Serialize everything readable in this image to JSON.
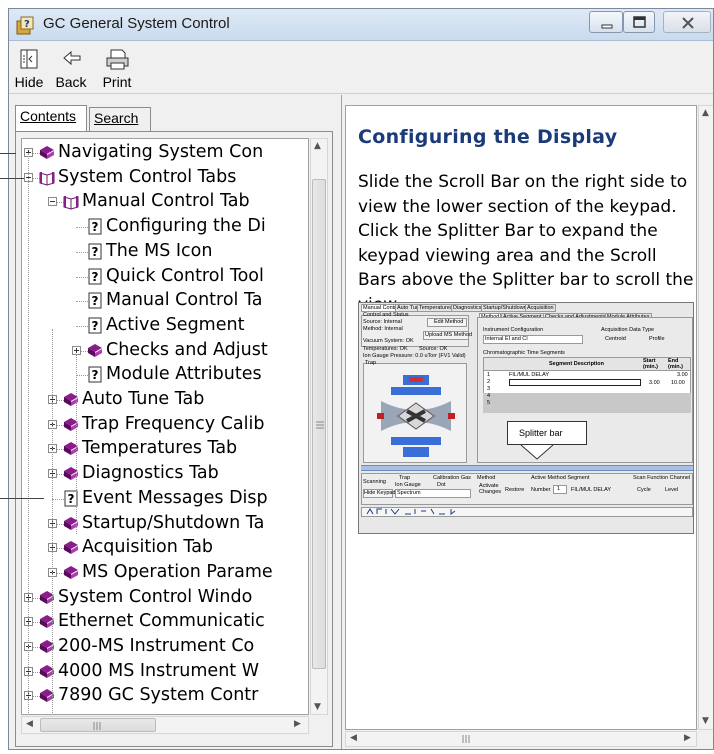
{
  "window": {
    "title": "GC General System Control"
  },
  "toolbar": {
    "hide_label": "Hide",
    "back_label": "Back",
    "print_label": "Print"
  },
  "tabs": {
    "contents": "Contents",
    "search": "Search"
  },
  "tree": [
    {
      "label": "Navigating System Con",
      "icon": "book-icon",
      "level": 0,
      "expander": "plus"
    },
    {
      "label": "System Control Tabs",
      "icon": "open-book-icon",
      "level": 0,
      "expander": "minus"
    },
    {
      "label": "Manual Control Tab",
      "icon": "open-book-icon",
      "level": 1,
      "expander": "minus"
    },
    {
      "label": "Configuring the Di",
      "icon": "help-page-icon",
      "level": 2,
      "expander": "none"
    },
    {
      "label": "The MS Icon",
      "icon": "help-page-icon",
      "level": 2,
      "expander": "none"
    },
    {
      "label": "Quick Control Tool",
      "icon": "help-page-icon",
      "level": 2,
      "expander": "none"
    },
    {
      "label": "Manual Control Ta",
      "icon": "help-page-icon",
      "level": 2,
      "expander": "none"
    },
    {
      "label": "Active Segment",
      "icon": "help-page-icon",
      "level": 2,
      "expander": "none"
    },
    {
      "label": "Checks and Adjust",
      "icon": "book-icon",
      "level": 2,
      "expander": "plus"
    },
    {
      "label": "Module Attributes",
      "icon": "help-page-icon",
      "level": 2,
      "expander": "none"
    },
    {
      "label": "Auto Tune Tab",
      "icon": "book-icon",
      "level": 1,
      "expander": "plus"
    },
    {
      "label": "Trap Frequency Calib",
      "icon": "book-icon",
      "level": 1,
      "expander": "plus"
    },
    {
      "label": "Temperatures Tab",
      "icon": "book-icon",
      "level": 1,
      "expander": "plus"
    },
    {
      "label": "Diagnostics Tab",
      "icon": "book-icon",
      "level": 1,
      "expander": "plus"
    },
    {
      "label": "Event Messages Disp",
      "icon": "help-page-icon",
      "level": 1,
      "expander": "none"
    },
    {
      "label": "Startup/Shutdown Ta",
      "icon": "book-icon",
      "level": 1,
      "expander": "plus"
    },
    {
      "label": "Acquisition Tab",
      "icon": "book-icon",
      "level": 1,
      "expander": "plus"
    },
    {
      "label": "MS Operation Parame",
      "icon": "book-icon",
      "level": 1,
      "expander": "plus"
    },
    {
      "label": "System Control Windo",
      "icon": "book-icon",
      "level": 0,
      "expander": "plus"
    },
    {
      "label": "Ethernet Communicatic",
      "icon": "book-icon",
      "level": 0,
      "expander": "plus"
    },
    {
      "label": "200-MS Instrument Co",
      "icon": "book-icon",
      "level": 0,
      "expander": "plus"
    },
    {
      "label": "4000 MS Instrument W",
      "icon": "book-icon",
      "level": 0,
      "expander": "plus"
    },
    {
      "label": "7890 GC System Contr",
      "icon": "book-icon",
      "level": 0,
      "expander": "plus"
    }
  ],
  "article": {
    "heading": "Configuring the Display",
    "body": "Slide the Scroll Bar on the right side to view the lower section of the keypad. Click the Splitter Bar to expand the keypad viewing area and the Scroll Bars above the Splitter bar to scroll the view."
  },
  "screenshot": {
    "tabs": [
      "Manual Control",
      "Auto Tune",
      "Temperatures",
      "Diagnostics",
      "Startup/Shutdown",
      "Acquisition"
    ],
    "subtabs": [
      "Method",
      "Active Segment",
      "Checks and Adjustments",
      "Module Attributes"
    ],
    "control_status": "Control and Status",
    "source": "Source: Internal",
    "method": "Method: Internal",
    "edit_method": "Edit Method",
    "upload_method": "Upload MS Method",
    "vacuum": "Vacuum System: OK",
    "temperatures": "Temperatures: OK",
    "source_ok": "Source: OK",
    "ion_gauge": "Ion Gauge Pressure: 0.0 uTorr (FV1 Valid)",
    "trap": "Trap",
    "instrument_config": "Instrument Configuration",
    "instrument_value": "Internal EI and CI",
    "acq_type": "Acquisition Data Type",
    "centroid": "Centroid",
    "profile": "Profile",
    "chrom_segments": "Chromatographic Time Segments",
    "seg_desc": "Segment Description",
    "start": "Start (min.)",
    "end": "End (min.)",
    "row1_desc": "FIL/MUL DELAY",
    "row1_end": "3.00",
    "row2_start": "3.00",
    "row2_end": "10.00",
    "splitter_label": "Splitter bar",
    "scanning": "Scanning",
    "trap_opt": "Trap",
    "ion_gauge_opt": "Ion Gauge",
    "calibration_gas": "Calibration Gas",
    "dot": "Dot",
    "hide_keypad": "Hide Keypad",
    "spectrum": "Spectrum",
    "method_grp": "Method",
    "activate_changes": "Activate Changes",
    "restore": "Restore",
    "active_method_segment": "Active Method Segment",
    "number_label": "Number",
    "number_value": "1",
    "active_desc": "FIL/MUL DELAY",
    "scan_function": "Scan Function Channel",
    "cycle": "Cycle",
    "level": "Level"
  }
}
